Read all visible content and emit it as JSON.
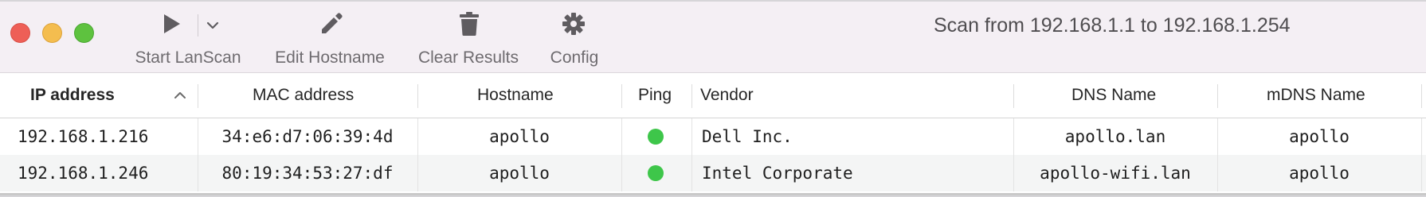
{
  "toolbar": {
    "start": {
      "label": "Start LanScan",
      "icon": "play-icon"
    },
    "start_menu": {
      "icon": "chevron-down-icon"
    },
    "edit": {
      "label": "Edit Hostname",
      "icon": "pencil-icon"
    },
    "clear": {
      "label": "Clear Results",
      "icon": "trash-icon"
    },
    "config": {
      "label": "Config",
      "icon": "gear-icon"
    },
    "scan_range": "Scan from 192.168.1.1 to 192.168.1.254"
  },
  "table": {
    "columns": {
      "ip": "IP address",
      "mac": "MAC address",
      "hostname": "Hostname",
      "ping": "Ping",
      "vendor": "Vendor",
      "dns": "DNS Name",
      "mdns": "mDNS Name"
    },
    "sort": {
      "column": "IP address",
      "direction": "ascending"
    },
    "rows": [
      {
        "ip": "192.168.1.216",
        "mac": "34:e6:d7:06:39:4d",
        "hostname": "apollo",
        "ping": "online",
        "vendor": "Dell Inc.",
        "dns": "apollo.lan",
        "mdns": "apollo"
      },
      {
        "ip": "192.168.1.246",
        "mac": "80:19:34:53:27:df",
        "hostname": "apollo",
        "ping": "online",
        "vendor": "Intel Corporate",
        "dns": "apollo-wifi.lan",
        "mdns": "apollo"
      }
    ]
  },
  "colors": {
    "ping_online": "#3ec64a",
    "toolbar_bg": "#f4eff4"
  }
}
